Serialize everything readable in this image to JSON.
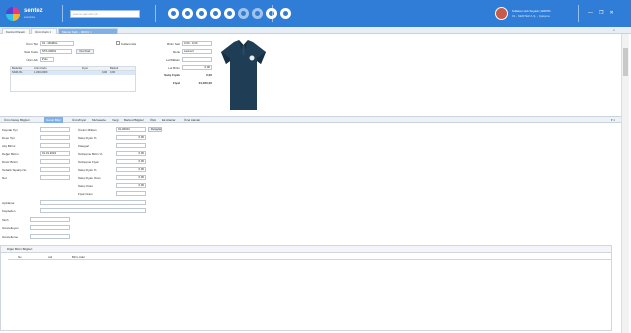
{
  "app": {
    "logo_text": "sentez",
    "logo_sub": "enterprise",
    "search_placeholder": "arama yapmak için...",
    "user_line1": "Kullanıcı Adı Soyadı | ERP01",
    "user_line2": "01 - SENTEZ A.Ş. - Çalışma",
    "window_controls": [
      "—",
      "❐",
      "✕"
    ]
  },
  "tabs": [
    {
      "label": "Kontrol Paneli"
    },
    {
      "label": "Ürün Kartı ×"
    },
    {
      "label": "Mamul Kartı - 00001 ×"
    }
  ],
  "tabs_close": "×",
  "form": {
    "urun_tipi_label": "Ürün Tipi",
    "urun_tipi_value": "01 - MAMUL",
    "kullanimda_label": "Kullanımda",
    "stok_kodu_label": "Stok Kodu",
    "stok_kodu_value": "STK-00001",
    "stok_kodu_btn": "Yeni Kod",
    "urun_adi_label": "Ürün Adı",
    "urun_adi_value": "Polo",
    "bedenler_label": "Beden Sertifi",
    "bedenler_value": "S-M-L",
    "grid_headers": [
      "Bedenler",
      "Ürün Kodu",
      "Fiyat",
      "Barkod"
    ],
    "grid_rows": [
      [
        "S/M/L/XL",
        "1-000-0000",
        "0,00",
        "0,00"
      ]
    ],
    "birim_seti_label": "Birim Seti",
    "birim_seti_value": "0,00 - 0,00",
    "renk_label": "Renk",
    "renk_value": "Lacivert",
    "lot_label": "Lot/Miktarı",
    "lot_value": "",
    "lot_birim_label": "Lot Birim",
    "lot_birim_value": "0,00",
    "satis_label": "Satış Fiyatı",
    "satis_value": "0,00",
    "fiyat_label": "Fiyat",
    "fiyat_value": "24,000,00"
  },
  "tabs2": [
    "Ürün Detay Bilgileri",
    "Genel Bilgi",
    "Ürün/Fiyat",
    "Muhasebe",
    "Vergi",
    "Barkod Bilgileri",
    "Ölçü",
    "Ek Alanlar",
    "Özel Alanlar"
  ],
  "tabs2_active_index": 1,
  "tabs2_ctrl": "▾ ×",
  "detail": {
    "left": [
      {
        "label": "Kaynak Tipi",
        "value": ""
      },
      {
        "label": "Depo Tipi",
        "value": ""
      },
      {
        "label": "Alış Birimi",
        "value": ""
      },
      {
        "label": "Değer Birimi",
        "value": "01.01.2019"
      },
      {
        "label": "Döviz Birimi",
        "value": ""
      },
      {
        "label": "Tedarik Sipariş No",
        "value": ""
      },
      {
        "label": "Not",
        "value": ""
      }
    ],
    "mid": [
      {
        "label": "Üretim Miktarı",
        "value": "01-00001"
      },
      {
        "label": "Satış Fiyatı %",
        "value": "0,00"
      },
      {
        "label": "Kategori",
        "value": ""
      },
      {
        "label": "Sözleşme Birim %",
        "value": "0,00"
      },
      {
        "label": "Sözleşme Fiyat",
        "value": "0,00"
      },
      {
        "label": "Satış Fiyatı %",
        "value": "0,00"
      },
      {
        "label": "Satış Fiyatı Oran",
        "value": "0,00"
      },
      {
        "label": "Satış Oranı",
        "value": "0,00"
      },
      {
        "label": "Fiyat Oranı",
        "value": ""
      }
    ],
    "mid_btn": "Detaylar",
    "bottom": [
      {
        "label": "Açıklama",
        "value": ""
      },
      {
        "label": "Kaydeden",
        "value": ""
      },
      {
        "label": "Tarih",
        "value": ""
      },
      {
        "label": "Güncelleyen",
        "value": ""
      },
      {
        "label": "Güncelleme",
        "value": ""
      }
    ]
  },
  "subgrid": {
    "title": "Diğer Birim Bilgileri",
    "headers": [
      "No",
      "Adı",
      "Birim Adet"
    ]
  },
  "colors": {
    "topbar": "#2f7dd6",
    "active_tab": "#7fb0e8",
    "shirt": "#1f3d55"
  },
  "icons": [
    "logo-mark",
    "search-icon",
    "toolbar-icon",
    "avatar",
    "minimize-icon",
    "maximize-icon",
    "close-icon"
  ]
}
